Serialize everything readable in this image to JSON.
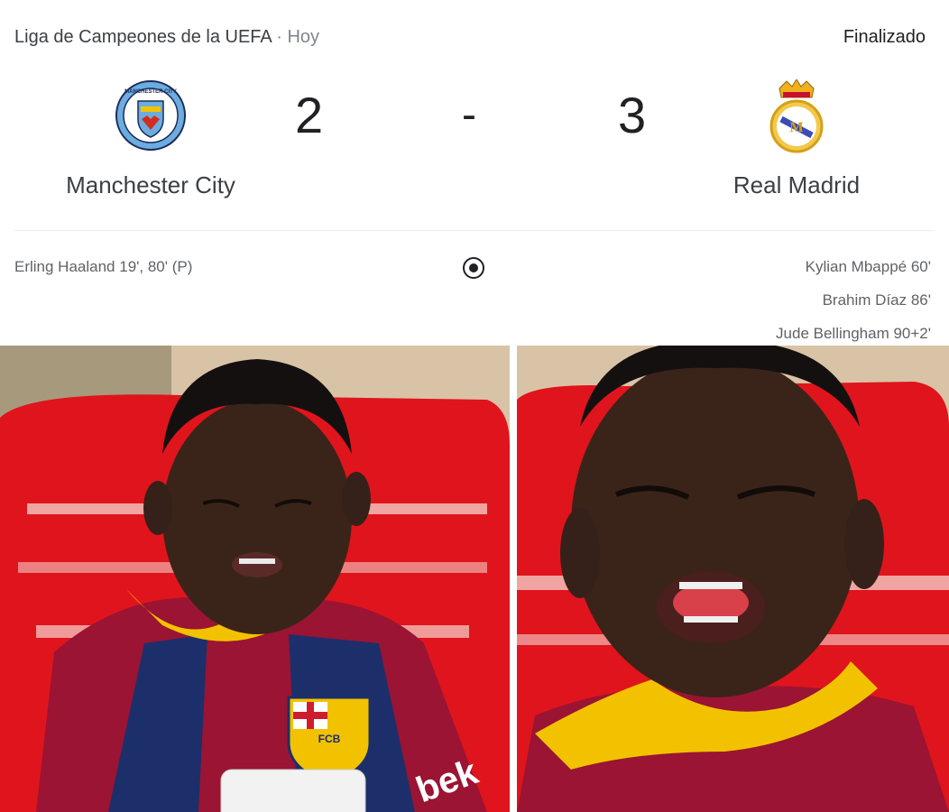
{
  "match": {
    "competition": "Liga de Campeones de la UEFA",
    "separator": "·",
    "day": "Hoy",
    "status": "Finalizado",
    "home": {
      "name": "Manchester City",
      "score": "2",
      "logo_icon": "manchester-city-crest-icon",
      "logo_text": "MANCHESTER CITY"
    },
    "away": {
      "name": "Real Madrid",
      "score": "3",
      "logo_icon": "real-madrid-crest-icon"
    },
    "dash": "-",
    "home_scorers": [
      "Erling Haaland 19', 80' (P)"
    ],
    "away_scorers": [
      "Kylian Mbappé 60'",
      "Brahim Díaz 86'",
      "Jude Bellingham 90+2'"
    ],
    "goal_icon": "soccer-ball-icon"
  },
  "photos": {
    "left": {
      "jersey_crest_text": "FCB",
      "jersey_sponsor_text": "bek"
    },
    "right": {}
  },
  "colors": {
    "chair_red": "#e0141c",
    "barca_blue": "#1c2f6b",
    "barca_red": "#9b1433",
    "collar_yellow": "#f2c200",
    "mancity_blue": "#6caddf"
  }
}
